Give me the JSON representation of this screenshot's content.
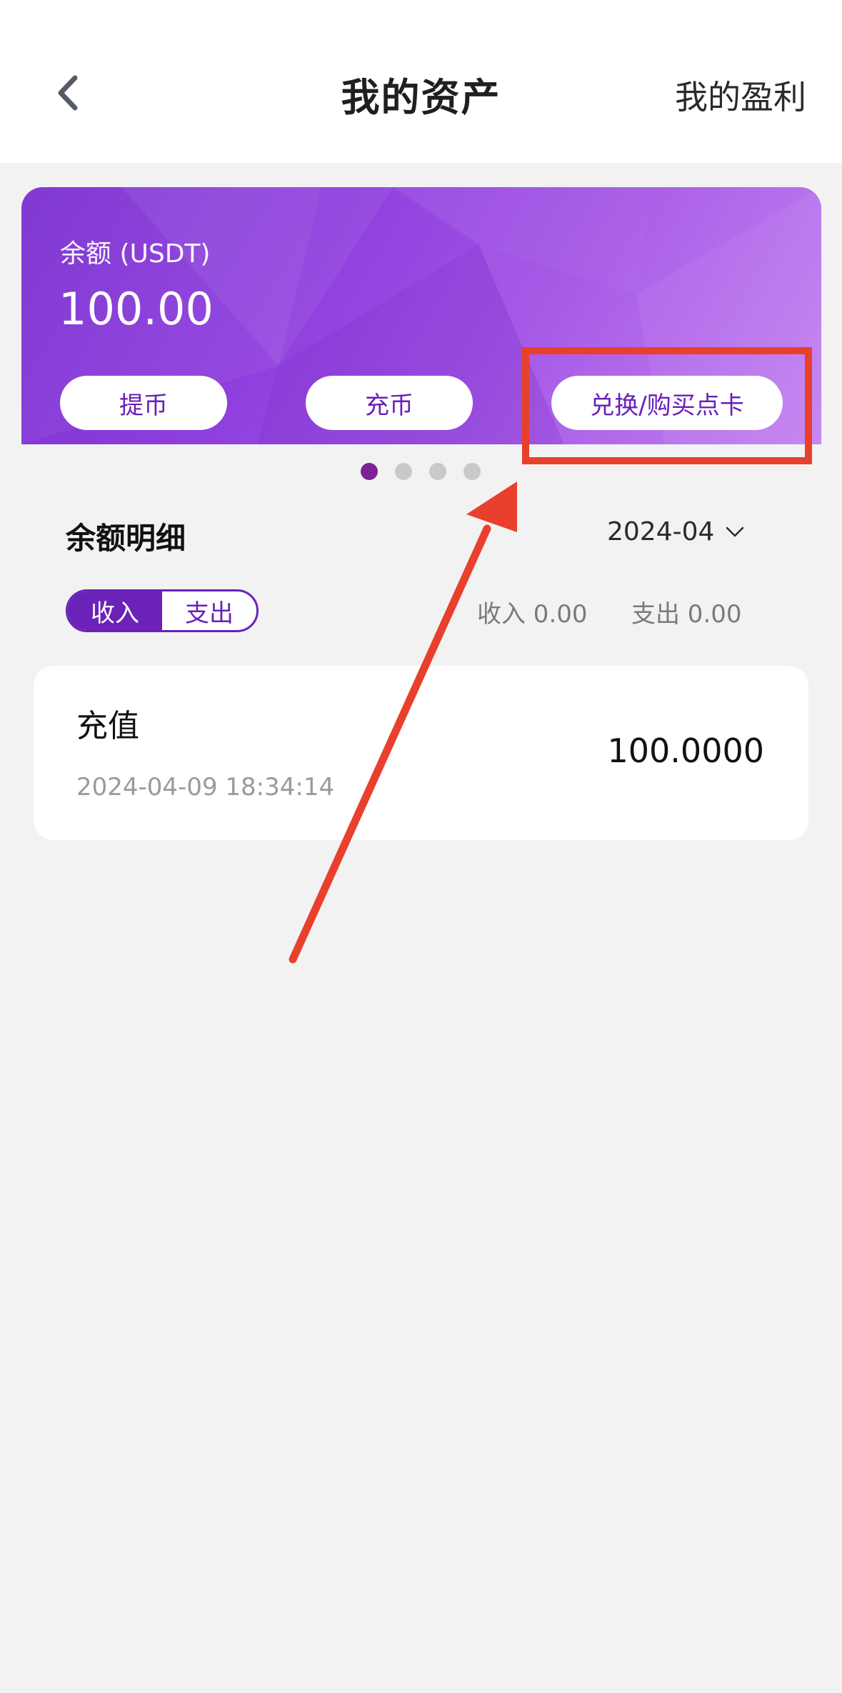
{
  "header": {
    "title": "我的资产",
    "profit_link": "我的盈利",
    "back_icon": "chevron-left-icon"
  },
  "balance_card": {
    "label": "余额 (USDT)",
    "value": "100.00",
    "buttons": {
      "withdraw": "提币",
      "deposit": "充币",
      "exchange": "兑换/购买点卡"
    },
    "gradient_colors": [
      "#7a2fd0",
      "#c07bf0"
    ],
    "button_text_color": "#6a1fb8"
  },
  "carousel": {
    "count": 4,
    "active_index": 0,
    "active_color": "#7b2394"
  },
  "details": {
    "title": "余额明细",
    "month": "2024-04",
    "toggle": {
      "income": "收入",
      "expense": "支出",
      "active": "income"
    },
    "summary": {
      "income": "收入 0.00",
      "expense": "支出 0.00"
    }
  },
  "records": [
    {
      "title": "充值",
      "time": "2024-04-09 18:34:14",
      "amount": "100.0000"
    }
  ],
  "annotations": {
    "highlight_color": "#e8402d",
    "arrow_color": "#e8402d"
  }
}
